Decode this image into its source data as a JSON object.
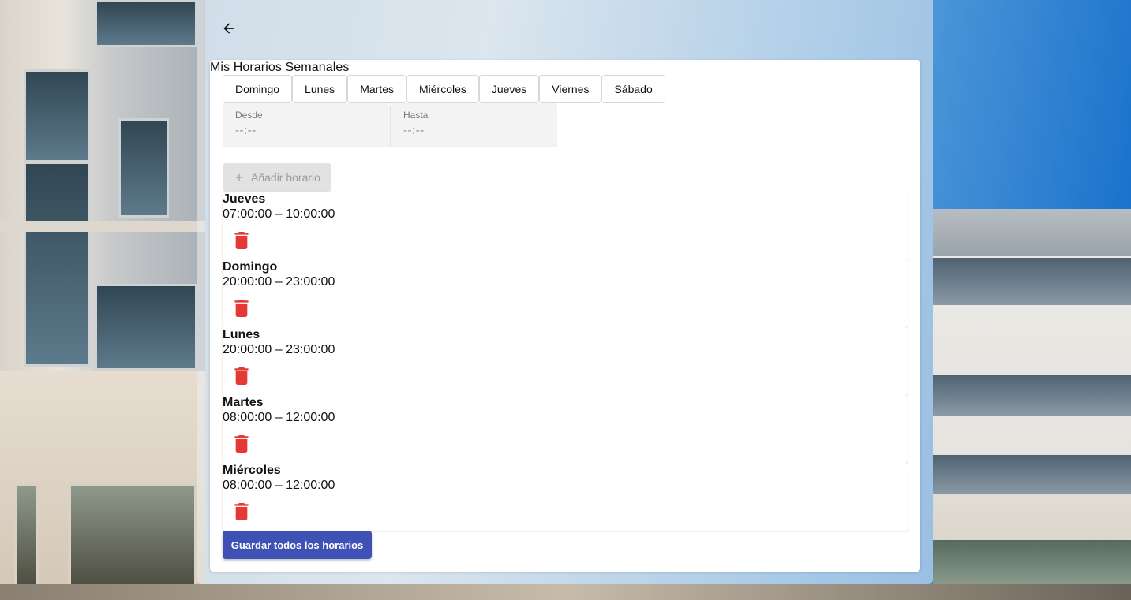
{
  "header": {
    "back_icon": "arrow-left-icon",
    "title": "Mis Horarios Semanales"
  },
  "day_tabs": [
    {
      "label": "Domingo"
    },
    {
      "label": "Lunes"
    },
    {
      "label": "Martes"
    },
    {
      "label": "Miércoles"
    },
    {
      "label": "Jueves"
    },
    {
      "label": "Viernes"
    },
    {
      "label": "Sábado"
    }
  ],
  "time_inputs": {
    "from": {
      "label": "Desde",
      "value": "--:--"
    },
    "to": {
      "label": "Hasta",
      "value": "--:--"
    }
  },
  "add_button": {
    "label": "Añadir horario",
    "icon": "plus-icon",
    "disabled": true
  },
  "schedules": [
    {
      "day": "Jueves",
      "range": "07:00:00 – 10:00:00"
    },
    {
      "day": "Domingo",
      "range": "20:00:00 – 23:00:00"
    },
    {
      "day": "Lunes",
      "range": "20:00:00 – 23:00:00"
    },
    {
      "day": "Martes",
      "range": "08:00:00 – 12:00:00"
    },
    {
      "day": "Miércoles",
      "range": "08:00:00 – 12:00:00"
    }
  ],
  "delete_icon": "trash-icon",
  "save_button": {
    "label": "Guardar todos los horarios"
  },
  "colors": {
    "primary": "#3f51b5",
    "danger": "#e53935",
    "disabled_bg": "#e2e2e2",
    "disabled_text": "#9a9a9a"
  }
}
